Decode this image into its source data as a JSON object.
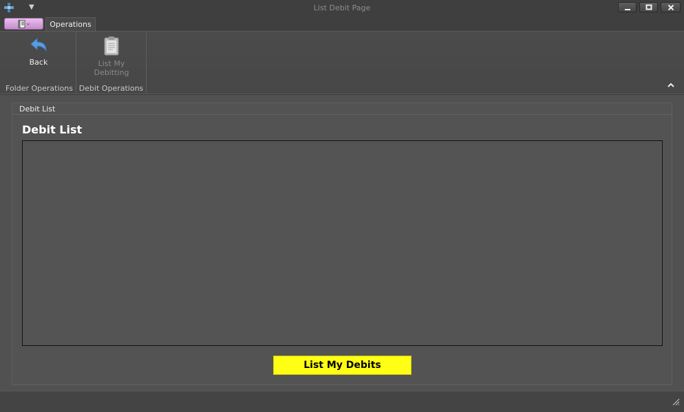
{
  "window": {
    "title": "List Debit Page",
    "icons": {
      "app": "app-icon",
      "qat": "chevron-down-icon",
      "minimize": "minimize-icon",
      "maximize": "maximize-icon",
      "close": "close-icon"
    }
  },
  "tabs": [
    {
      "label": "Operations",
      "active": true
    }
  ],
  "app_menu": {
    "icon": "document-icon",
    "color": "#d9a8df"
  },
  "ribbon": {
    "groups": [
      {
        "caption": "Folder Operations",
        "buttons": [
          {
            "label": "Back",
            "icon": "back-arrow-icon",
            "enabled": true
          }
        ]
      },
      {
        "caption": "Debit Operations",
        "buttons": [
          {
            "label": "List My Debitting",
            "icon": "clipboard-icon",
            "enabled": false
          }
        ]
      }
    ],
    "collapse_icon": "chevron-up-icon"
  },
  "main": {
    "groupbox_caption": "Debit List",
    "heading": "Debit List",
    "action_button": {
      "label": "List My Debits",
      "color": "#ffff15"
    }
  },
  "statusbar": {
    "grip_icon": "resize-grip-icon"
  },
  "colors": {
    "background": "#515151",
    "accent_back_icon": "#5b9be0"
  }
}
